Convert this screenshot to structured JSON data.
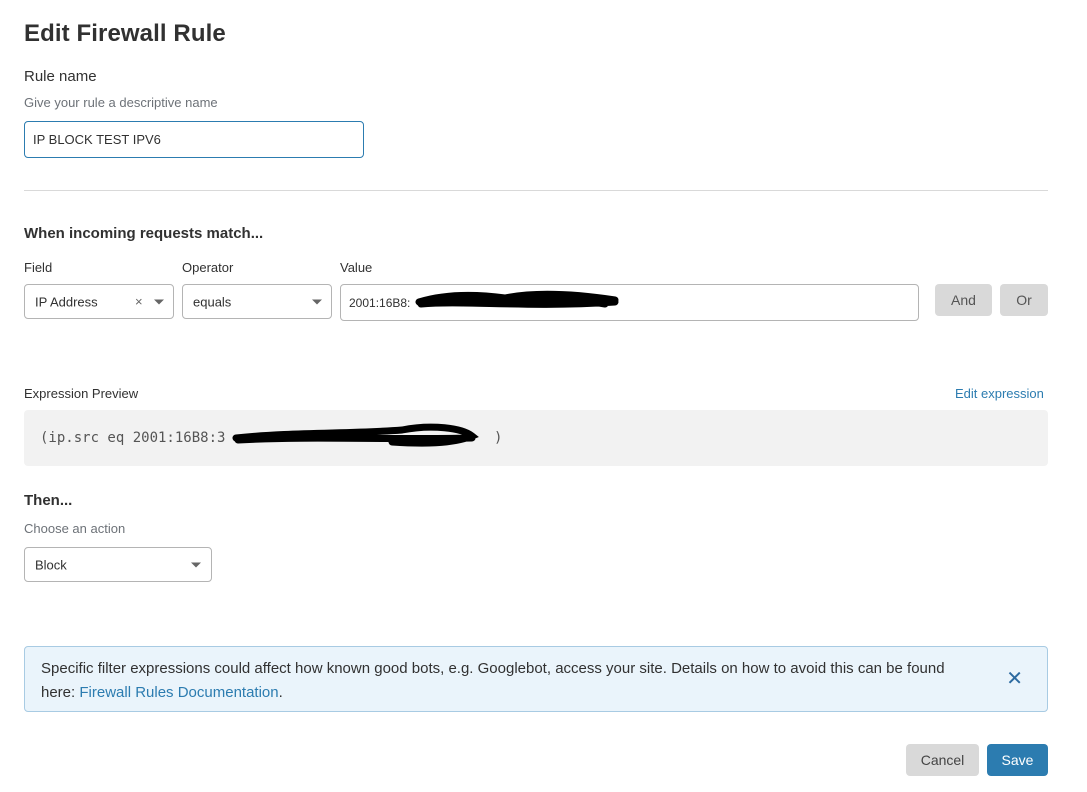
{
  "page": {
    "title": "Edit Firewall Rule"
  },
  "rule_name": {
    "label": "Rule name",
    "hint": "Give your rule a descriptive name",
    "value": "IP BLOCK TEST IPV6"
  },
  "match": {
    "heading": "When incoming requests match...",
    "field_label": "Field",
    "field_value": "IP Address",
    "clear_glyph": "×",
    "operator_label": "Operator",
    "operator_value": "equals",
    "value_label": "Value",
    "value_text": "2001:16B8:",
    "and_label": "And",
    "or_label": "Or"
  },
  "expression": {
    "label": "Expression Preview",
    "edit_link": "Edit expression",
    "text": "(ip.src eq 2001:16B8:3",
    "text_end": ")"
  },
  "then": {
    "heading": "Then...",
    "hint": "Choose an action",
    "action_value": "Block"
  },
  "notice": {
    "text_before": "Specific filter expressions could affect how known good bots, e.g. Googlebot, access your site. Details on how to avoid this can be found here: ",
    "link": "Firewall Rules Documentation",
    "text_after": ".",
    "close_glyph": "✕"
  },
  "footer": {
    "cancel_label": "Cancel",
    "save_label": "Save"
  },
  "colors": {
    "accent": "#2c7cb0",
    "notice_bg": "#eaf4fb",
    "button_grey": "#d9d9d9",
    "redaction": "#000000"
  },
  "icons": [
    "chevron-down-icon",
    "clear-icon",
    "close-icon"
  ]
}
